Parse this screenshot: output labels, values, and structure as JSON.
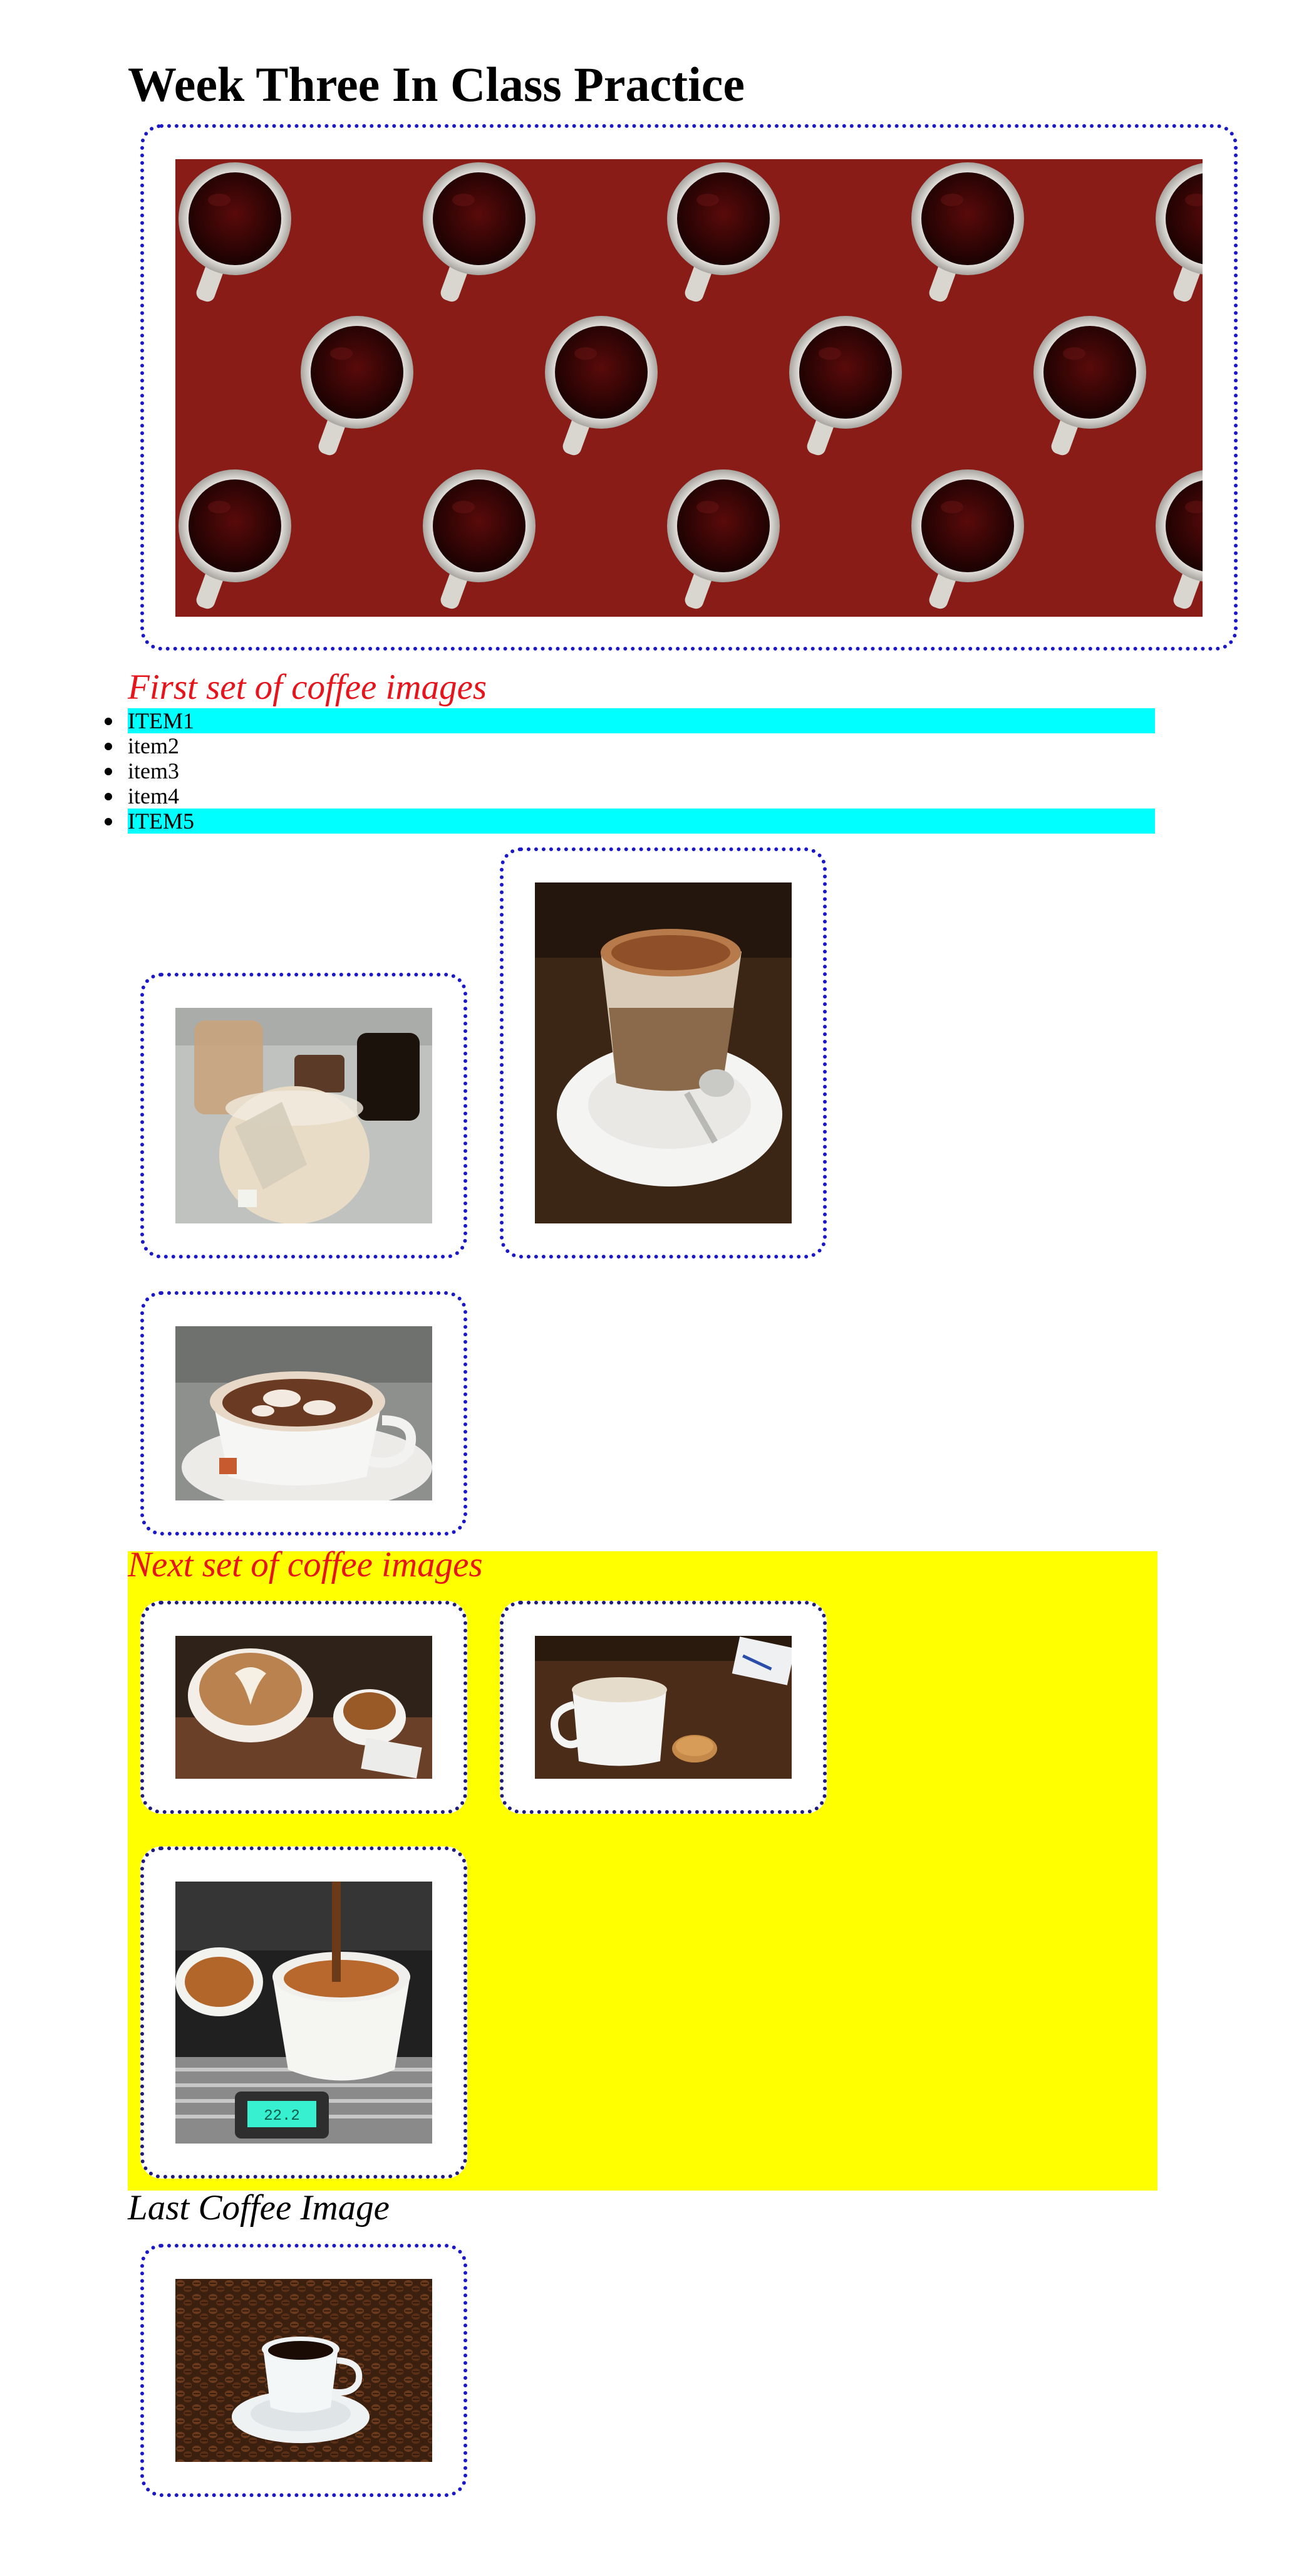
{
  "page": {
    "title": "Week Three In Class Practice"
  },
  "colors": {
    "frame_border": "#1a18c8",
    "frame_border_dark": "#1e1a7e",
    "caption_red": "#e8141b",
    "highlight_cyan": "#00ffff",
    "section_yellow": "#ffff00",
    "banner_red": "#8a1c17"
  },
  "sections": {
    "first_caption": "First set of coffee images",
    "next_caption": "Next set of coffee images",
    "last_caption": "Last Coffee Image"
  },
  "list": {
    "items": [
      {
        "label": "ITEM1",
        "highlighted": true
      },
      {
        "label": "item2",
        "highlighted": false
      },
      {
        "label": "item3",
        "highlighted": false
      },
      {
        "label": "item4",
        "highlighted": false
      },
      {
        "label": "ITEM5",
        "highlighted": true
      }
    ]
  }
}
